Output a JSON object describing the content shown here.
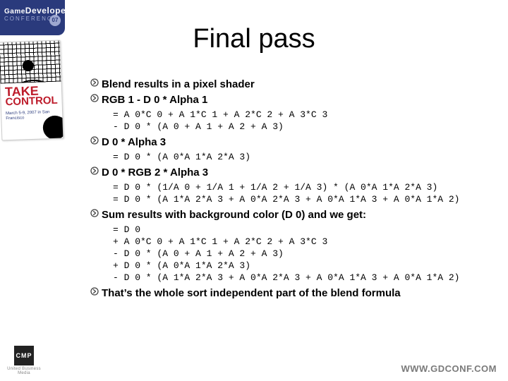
{
  "brand": {
    "top_line_a": "Game",
    "top_line_b": "Developers",
    "top_line_c": "CONFERENCE",
    "year_badge": "07",
    "card_take": "TAKE",
    "card_ctrl": "CONTROL",
    "card_dates": "March 5-9, 2007 in San Francisco",
    "cmp": "CMP",
    "cmp_sub": "United Business Media"
  },
  "footer": {
    "url": "WWW.GDCONF.COM"
  },
  "title": "Final pass",
  "bullets": [
    {
      "text": "Blend results in a pixel shader"
    },
    {
      "text": "RGB 1 - D 0 * Alpha 1",
      "code": "= A 0*C 0 + A 1*C 1 + A 2*C 2 + A 3*C 3\n- D 0 * (A 0 + A 1 + A 2 + A 3)"
    },
    {
      "text": "D 0 * Alpha 3",
      "code": "= D 0 * (A 0*A 1*A 2*A 3)"
    },
    {
      "text": "D 0 * RGB 2 * Alpha 3",
      "code": "= D 0 * (1/A 0 + 1/A 1 + 1/A 2 + 1/A 3) * (A 0*A 1*A 2*A 3)\n= D 0 * (A 1*A 2*A 3 + A 0*A 2*A 3 + A 0*A 1*A 3 + A 0*A 1*A 2)"
    },
    {
      "text": "Sum results with background color (D 0) and we get:",
      "code": "= D 0\n+ A 0*C 0 + A 1*C 1 + A 2*C 2 + A 3*C 3\n- D 0 * (A 0 + A 1 + A 2 + A 3)\n+ D 0 * (A 0*A 1*A 2*A 3)\n- D 0 * (A 1*A 2*A 3 + A 0*A 2*A 3 + A 0*A 1*A 3 + A 0*A 1*A 2)"
    },
    {
      "text": "That’s the whole sort independent part of the blend formula"
    }
  ]
}
